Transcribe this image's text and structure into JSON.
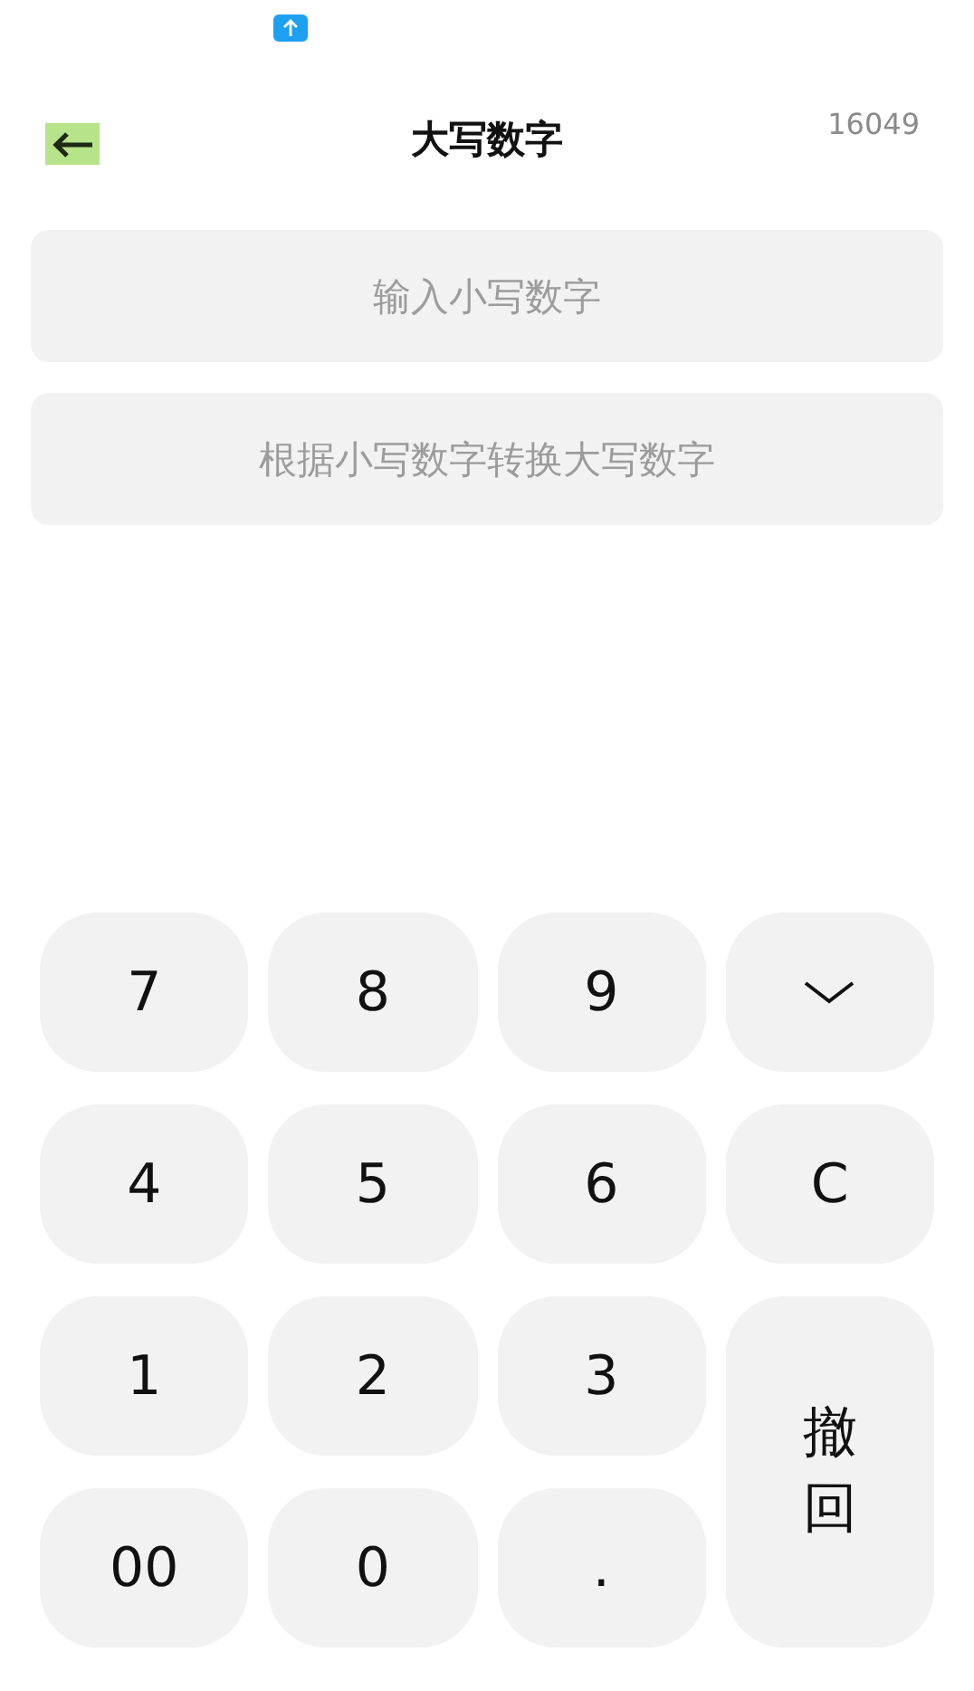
{
  "header": {
    "title": "大写数字",
    "counter": "16049"
  },
  "fields": [
    {
      "placeholder": "输入小写数字"
    },
    {
      "placeholder": "根据小写数字转换大写数字"
    }
  ],
  "keypad": [
    {
      "kind": "text",
      "label": "7"
    },
    {
      "kind": "text",
      "label": "8"
    },
    {
      "kind": "text",
      "label": "9"
    },
    {
      "kind": "chevron"
    },
    {
      "kind": "text",
      "label": "4"
    },
    {
      "kind": "text",
      "label": "5"
    },
    {
      "kind": "text",
      "label": "6"
    },
    {
      "kind": "text",
      "label": "C"
    },
    {
      "kind": "text",
      "label": "1"
    },
    {
      "kind": "text",
      "label": "2"
    },
    {
      "kind": "text",
      "label": "3"
    },
    {
      "kind": "tall",
      "label": "撤回"
    },
    {
      "kind": "text",
      "label": "00"
    },
    {
      "kind": "text",
      "label": "0"
    },
    {
      "kind": "text",
      "label": "."
    }
  ]
}
